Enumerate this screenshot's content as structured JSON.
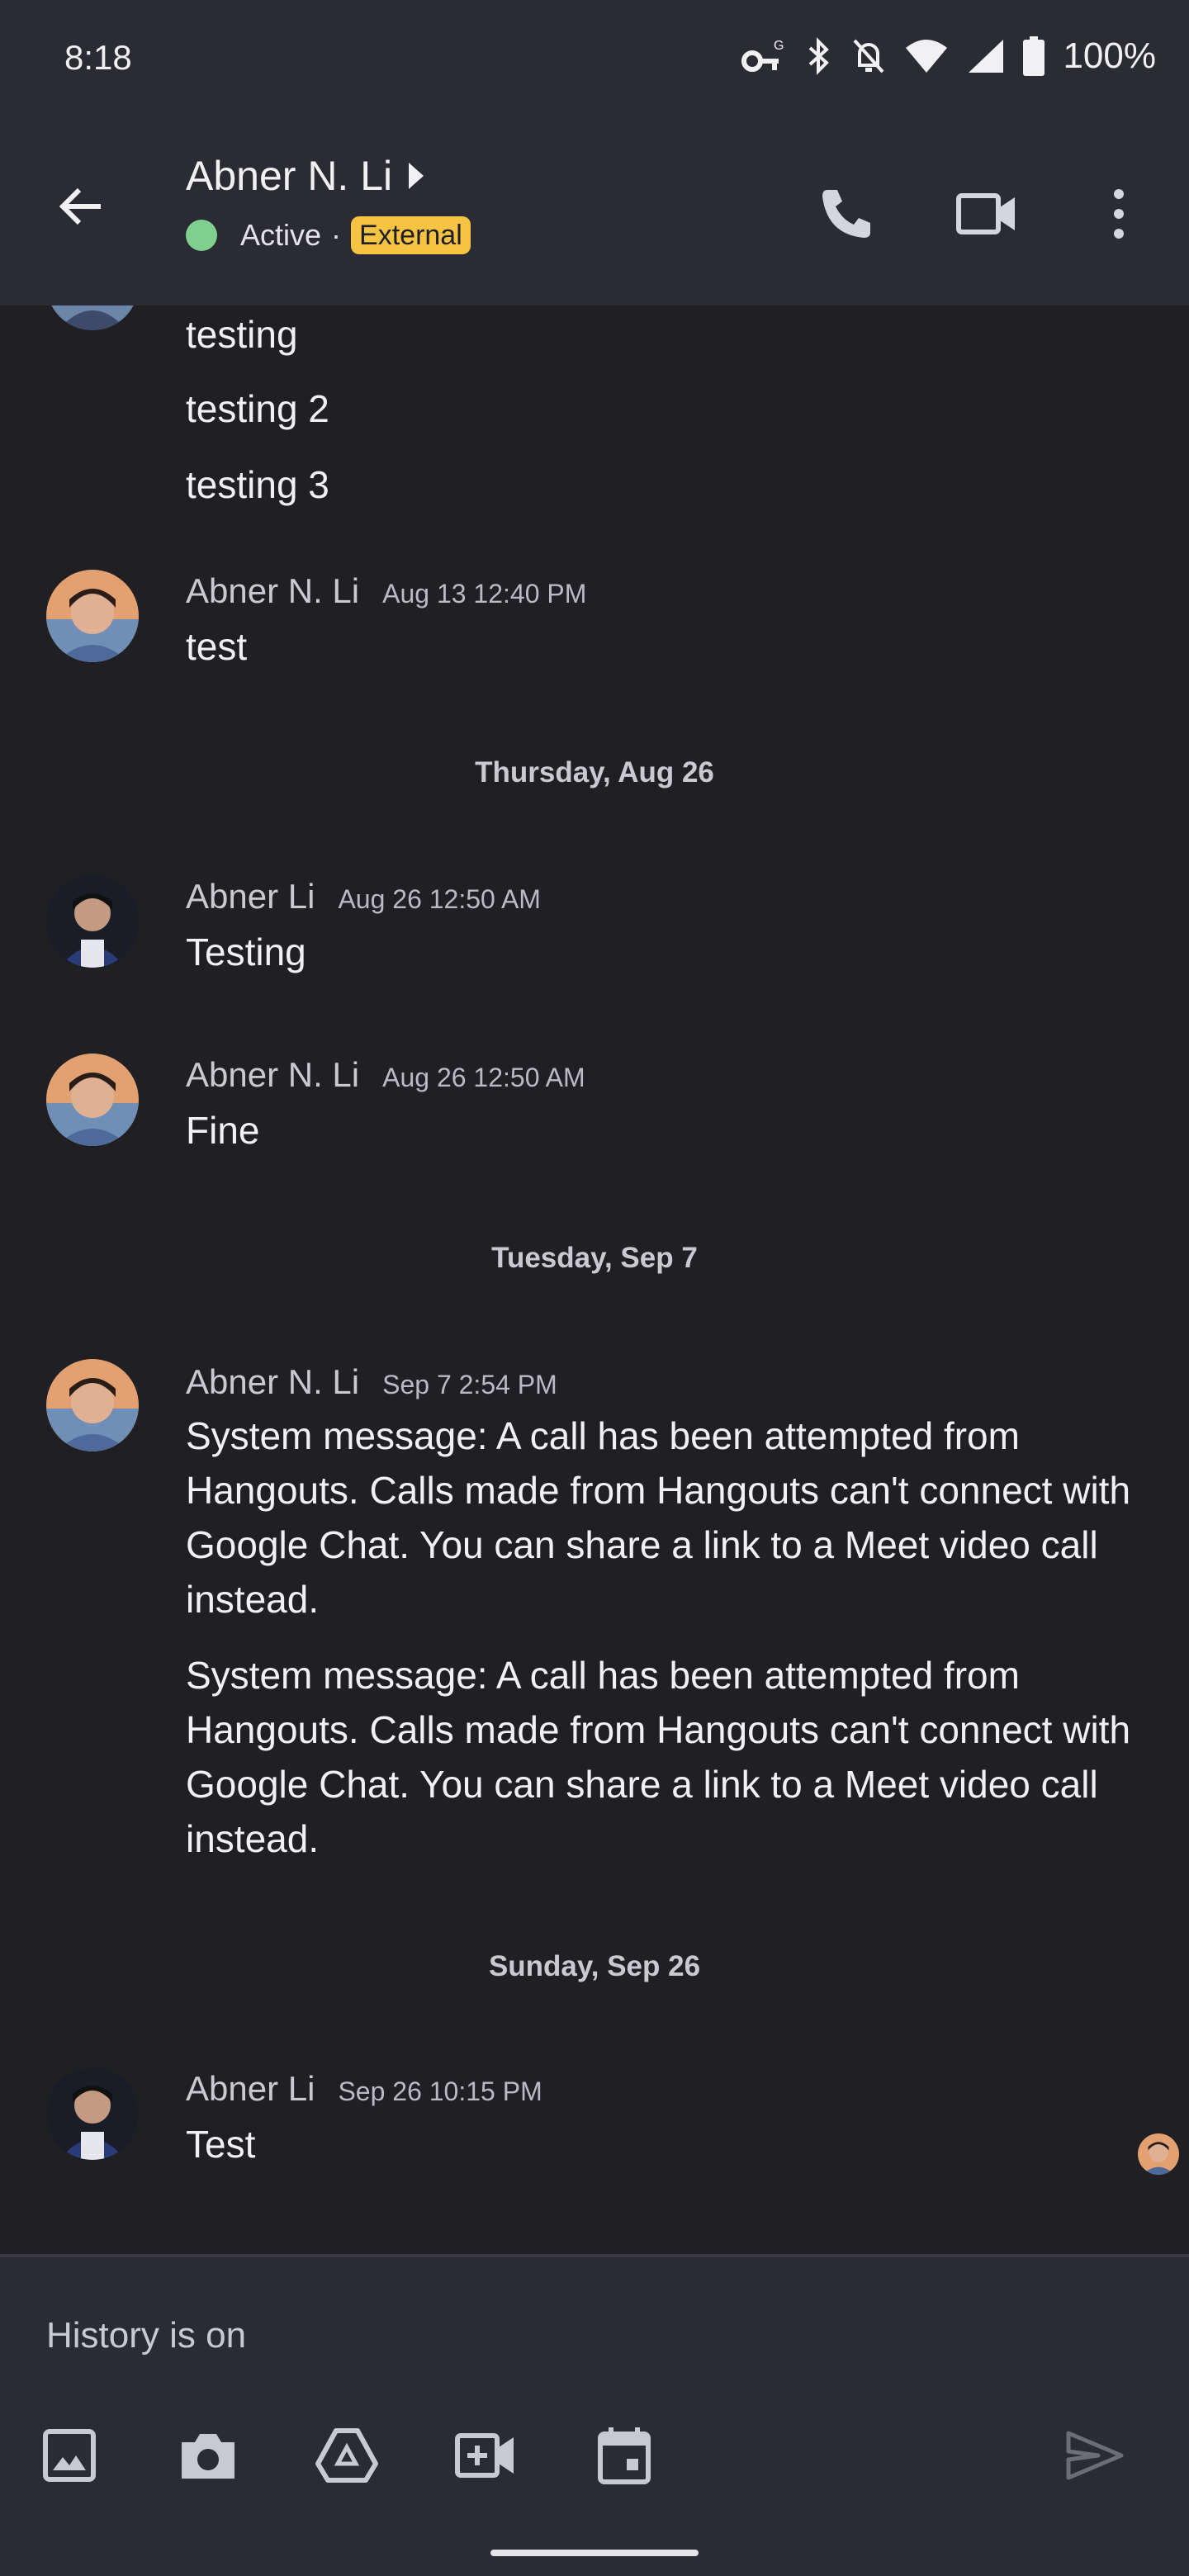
{
  "status_bar": {
    "time": "8:18",
    "battery": "100%"
  },
  "header": {
    "contact_name": "Abner N. Li",
    "presence": "Active",
    "separator": "·",
    "badge": "External",
    "icons": [
      "arrow-back-icon",
      "phone-icon",
      "video-icon",
      "more-vert-icon"
    ]
  },
  "messages": {
    "cont_1": "testing",
    "cont_2": "testing 2",
    "cont_3": "testing 3",
    "m1": {
      "sender": "Abner N. Li",
      "time": "Aug 13 12:40 PM",
      "text": "test"
    },
    "date_1": "Thursday, Aug 26",
    "m2": {
      "sender": "Abner Li",
      "time": "Aug 26 12:50 AM",
      "text": "Testing"
    },
    "m3": {
      "sender": "Abner N. Li",
      "time": "Aug 26 12:50 AM",
      "text": "Fine"
    },
    "date_2": "Tuesday, Sep 7",
    "m4": {
      "sender": "Abner N. Li",
      "time": "Sep 7 2:54 PM",
      "text": "System message: A call has been attempted from Hangouts. Calls made from Hangouts can't connect with Google Chat. You can share a link to a Meet video call instead.",
      "text_2": "System message: A call has been attempted from Hangouts. Calls made from Hangouts can't connect with Google Chat. You can share a link to a Meet video call instead."
    },
    "date_3": "Sunday, Sep 26",
    "m5": {
      "sender": "Abner Li",
      "time": "Sep 26 10:15 PM",
      "text": "Test"
    }
  },
  "composer": {
    "placeholder": "History is on",
    "tools": [
      "image-icon",
      "camera-icon",
      "drive-icon",
      "add-meet-icon",
      "calendar-icon",
      "send-icon"
    ]
  },
  "colors": {
    "background": "#1f1f24",
    "bar": "#2b2c33",
    "presence": "#7fcf8e",
    "badge": "#f6c342"
  }
}
